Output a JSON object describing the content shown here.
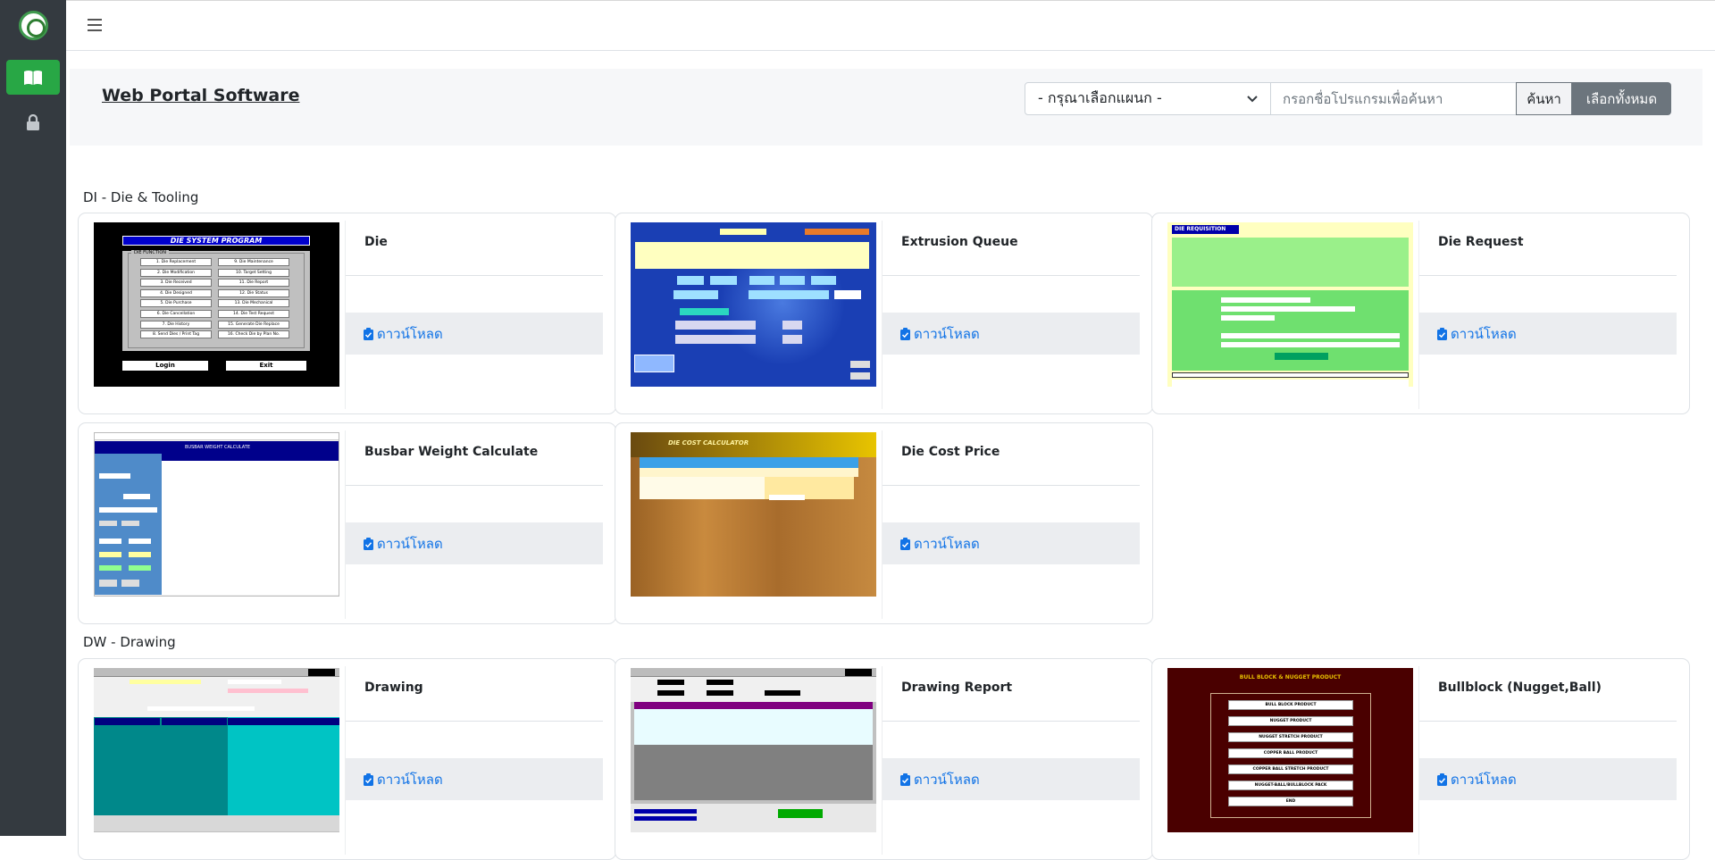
{
  "sidebar": {
    "logo_icon": "company-logo-icon",
    "items": [
      {
        "icon": "book-icon",
        "active": true
      },
      {
        "icon": "lock-icon",
        "active": false
      }
    ],
    "accent_color": "#28a745"
  },
  "header": {
    "title": "Web Portal Software",
    "department_select": {
      "value": "- กรุณาเลือกแผนก -"
    },
    "search": {
      "placeholder": "กรอกชื่อโปรแกรมเพื่อค้นหา",
      "value": ""
    },
    "search_button": "ค้นหา",
    "select_all_button": "เลือกทั้งหมด"
  },
  "sections": [
    {
      "title": "DI - Die & Tooling",
      "cards": [
        {
          "name": "Die",
          "download": "ดาวน์โหลด",
          "thumb": "die-system"
        },
        {
          "name": "Extrusion Queue",
          "download": "ดาวน์โหลด",
          "thumb": "extrusion-queue"
        },
        {
          "name": "Die Request",
          "download": "ดาวน์โหลด",
          "thumb": "die-request"
        },
        {
          "name": "Busbar Weight Calculate",
          "download": "ดาวน์โหลด",
          "thumb": "busbar"
        },
        {
          "name": "Die Cost Price",
          "download": "ดาวน์โหลด",
          "thumb": "die-cost"
        }
      ]
    },
    {
      "title": "DW - Drawing",
      "cards": [
        {
          "name": "Drawing",
          "download": "ดาวน์โหลด",
          "thumb": "drawing"
        },
        {
          "name": "Drawing Report",
          "download": "ดาวน์โหลด",
          "thumb": "drawing-report"
        },
        {
          "name": "Bullblock (Nugget,Ball)",
          "download": "ดาวน์โหลด",
          "thumb": "bullblock"
        }
      ]
    }
  ],
  "thumbnails": {
    "die_system": {
      "title": "DIE SYSTEM PROGRAM",
      "panel_title": "DIE FUNCTION",
      "left_items": [
        "1. Die Replacement",
        "2. Die Modification",
        "3. Die Received",
        "4. Die Designed",
        "5. Die Purchase",
        "6. Die Cancellation",
        "7. Die History",
        "8. Send Dies / Print Tag"
      ],
      "right_items": [
        "9. Die Maintenance",
        "10. Target Setting",
        "11. Die Report",
        "12. Die Status",
        "13. Die Mechanical",
        "14. Die Test Request",
        "15. Generate Die Replace",
        "16. Check Die by Plan No."
      ],
      "login": "Login",
      "exit": "Exit"
    },
    "die_request": {
      "title": "DIE REQUISITION"
    },
    "busbar": {
      "title": "BUSBAR WEIGHT CALCULATE"
    },
    "die_cost": {
      "title": "DIE COST CALCULATOR"
    },
    "bullblock": {
      "title": "BULL BLOCK & NUGGET PRODUCT",
      "items": [
        "BULL BLOCK PRODUCT",
        "NUGGET PRODUCT",
        "NUGGET STRETCH PRODUCT",
        "COPPER BALL PRODUCT",
        "COPPER BALL STRETCH PRODUCT",
        "NUGGET-BALL/BULLBLOCK PACK",
        "END"
      ]
    }
  }
}
